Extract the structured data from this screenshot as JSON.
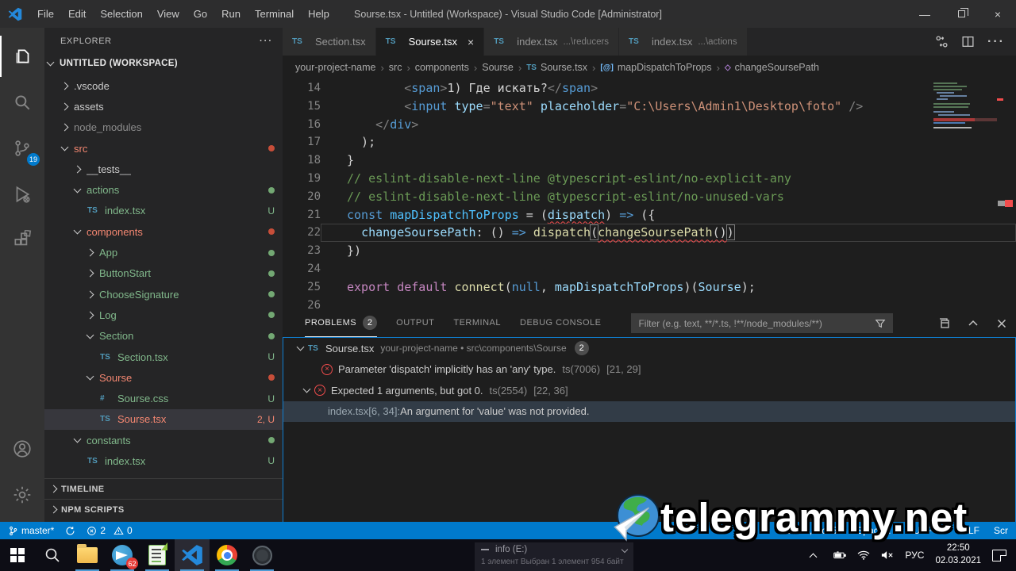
{
  "window": {
    "title": "Sourse.tsx - Untitled (Workspace) - Visual Studio Code [Administrator]",
    "menus": [
      "File",
      "Edit",
      "Selection",
      "View",
      "Go",
      "Run",
      "Terminal",
      "Help"
    ],
    "controls": {
      "minimize": "—",
      "close": "×"
    }
  },
  "activity": {
    "scm_badge": "19"
  },
  "explorer": {
    "header": "EXPLORER",
    "more": "···",
    "workspace": "UNTITLED (WORKSPACE)",
    "items": [
      {
        "indent": 0,
        "chev": "right",
        "label": ".vscode",
        "color": "default"
      },
      {
        "indent": 0,
        "chev": "right",
        "label": "assets",
        "color": "default"
      },
      {
        "indent": 0,
        "chev": "right",
        "label": "node_modules",
        "color": "dim"
      },
      {
        "indent": 0,
        "chev": "down",
        "label": "src",
        "color": "red",
        "dot": "red"
      },
      {
        "indent": 1,
        "chev": "right",
        "label": "__tests__",
        "color": "default"
      },
      {
        "indent": 1,
        "chev": "down",
        "label": "actions",
        "color": "green",
        "dot": "green"
      },
      {
        "indent": 2,
        "icon": "TS",
        "label": "index.tsx",
        "color": "green",
        "badge": "U"
      },
      {
        "indent": 1,
        "chev": "down",
        "label": "components",
        "color": "red",
        "dot": "red"
      },
      {
        "indent": 2,
        "chev": "right",
        "label": "App",
        "color": "green",
        "dot": "green"
      },
      {
        "indent": 2,
        "chev": "right",
        "label": "ButtonStart",
        "color": "green",
        "dot": "green"
      },
      {
        "indent": 2,
        "chev": "right",
        "label": "ChooseSignature",
        "color": "green",
        "dot": "green"
      },
      {
        "indent": 2,
        "chev": "right",
        "label": "Log",
        "color": "green",
        "dot": "green"
      },
      {
        "indent": 2,
        "chev": "down",
        "label": "Section",
        "color": "green",
        "dot": "green"
      },
      {
        "indent": 3,
        "icon": "TS",
        "label": "Section.tsx",
        "color": "green",
        "badge": "U"
      },
      {
        "indent": 2,
        "chev": "down",
        "label": "Sourse",
        "color": "red",
        "dot": "red"
      },
      {
        "indent": 3,
        "icon": "#",
        "label": "Sourse.css",
        "color": "green",
        "badge": "U"
      },
      {
        "indent": 3,
        "icon": "TS",
        "label": "Sourse.tsx",
        "color": "red",
        "badge": "2, U",
        "selected": true
      },
      {
        "indent": 1,
        "chev": "down",
        "label": "constants",
        "color": "green",
        "dot": "green"
      },
      {
        "indent": 2,
        "icon": "TS",
        "label": "index.tsx",
        "color": "green",
        "badge": "U"
      }
    ],
    "sections": [
      "TIMELINE",
      "NPM SCRIPTS"
    ]
  },
  "tabs": [
    {
      "icon": "TS",
      "label": "Section.tsx",
      "detail": "",
      "active": false,
      "close": false
    },
    {
      "icon": "TS",
      "label": "Sourse.tsx",
      "detail": "",
      "active": true,
      "close": true
    },
    {
      "icon": "TS",
      "label": "index.tsx",
      "detail": "...\\reducers",
      "active": false,
      "close": false
    },
    {
      "icon": "TS",
      "label": "index.tsx",
      "detail": "...\\actions",
      "active": false,
      "close": false
    }
  ],
  "breadcrumbs": [
    {
      "label": "your-project-name"
    },
    {
      "label": "src"
    },
    {
      "label": "components"
    },
    {
      "label": "Sourse"
    },
    {
      "label": "Sourse.tsx",
      "sym": "TS",
      "symColor": "#519aba"
    },
    {
      "label": "mapDispatchToProps",
      "sym": "[@]",
      "symColor": "#75beff"
    },
    {
      "label": "changeSoursePath",
      "sym": "◇",
      "symColor": "#b180d7"
    }
  ],
  "editor": {
    "lines": [
      {
        "num": "14",
        "segs": [
          {
            "t": "        ",
            "c": "txt"
          },
          {
            "t": "<",
            "c": "punct"
          },
          {
            "t": "span",
            "c": "tag"
          },
          {
            "t": ">",
            "c": "punct"
          },
          {
            "t": "1) Где искать?",
            "c": "txt"
          },
          {
            "t": "</",
            "c": "punct"
          },
          {
            "t": "span",
            "c": "tag"
          },
          {
            "t": ">",
            "c": "punct"
          }
        ]
      },
      {
        "num": "15",
        "segs": [
          {
            "t": "        ",
            "c": "txt"
          },
          {
            "t": "<",
            "c": "punct"
          },
          {
            "t": "input",
            "c": "tag"
          },
          {
            "t": " ",
            "c": "txt"
          },
          {
            "t": "type",
            "c": "attr"
          },
          {
            "t": "=",
            "c": "punct"
          },
          {
            "t": "\"text\"",
            "c": "str"
          },
          {
            "t": " ",
            "c": "txt"
          },
          {
            "t": "placeholder",
            "c": "attr"
          },
          {
            "t": "=",
            "c": "punct"
          },
          {
            "t": "\"C:\\Users\\Admin1\\Desktop\\foto\"",
            "c": "str"
          },
          {
            "t": " ",
            "c": "txt"
          },
          {
            "t": "/>",
            "c": "punct"
          }
        ]
      },
      {
        "num": "16",
        "segs": [
          {
            "t": "    ",
            "c": "txt"
          },
          {
            "t": "</",
            "c": "punct"
          },
          {
            "t": "div",
            "c": "tag"
          },
          {
            "t": ">",
            "c": "punct"
          }
        ]
      },
      {
        "num": "17",
        "segs": [
          {
            "t": "  );",
            "c": "txt"
          }
        ]
      },
      {
        "num": "18",
        "segs": [
          {
            "t": "}",
            "c": "txt"
          }
        ]
      },
      {
        "num": "19",
        "segs": [
          {
            "t": "// eslint-disable-next-line @typescript-eslint/no-explicit-any",
            "c": "cm"
          }
        ]
      },
      {
        "num": "20",
        "segs": [
          {
            "t": "// eslint-disable-next-line @typescript-eslint/no-unused-vars",
            "c": "cm"
          }
        ]
      },
      {
        "num": "21",
        "segs": [
          {
            "t": "const",
            "c": "kw"
          },
          {
            "t": " ",
            "c": "txt"
          },
          {
            "t": "mapDispatchToProps",
            "c": "cvar"
          },
          {
            "t": " = (",
            "c": "txt"
          },
          {
            "t": "dispatch",
            "c": "var sq"
          },
          {
            "t": ") ",
            "c": "txt"
          },
          {
            "t": "=>",
            "c": "kw"
          },
          {
            "t": " ({",
            "c": "txt"
          }
        ]
      },
      {
        "num": "22",
        "current": true,
        "segs": [
          {
            "t": "  ",
            "c": "txt"
          },
          {
            "t": "changeSoursePath",
            "c": "var"
          },
          {
            "t": ": () ",
            "c": "txt"
          },
          {
            "t": "=>",
            "c": "kw"
          },
          {
            "t": " ",
            "c": "txt"
          },
          {
            "t": "dispatch",
            "c": "fn"
          },
          {
            "t": "(",
            "c": "txt br"
          },
          {
            "t": "changeSoursePath",
            "c": "fn sq"
          },
          {
            "t": "()",
            "c": "txt sq"
          },
          {
            "t": ")",
            "c": "txt br"
          }
        ]
      },
      {
        "num": "23",
        "segs": [
          {
            "t": "})",
            "c": "txt"
          }
        ]
      },
      {
        "num": "24",
        "segs": []
      },
      {
        "num": "25",
        "segs": [
          {
            "t": "export",
            "c": "kw2"
          },
          {
            "t": " ",
            "c": "txt"
          },
          {
            "t": "default",
            "c": "kw2"
          },
          {
            "t": " ",
            "c": "txt"
          },
          {
            "t": "connect",
            "c": "fn"
          },
          {
            "t": "(",
            "c": "txt"
          },
          {
            "t": "null",
            "c": "kw"
          },
          {
            "t": ", ",
            "c": "txt"
          },
          {
            "t": "mapDispatchToProps",
            "c": "var"
          },
          {
            "t": ")(",
            "c": "txt"
          },
          {
            "t": "Sourse",
            "c": "var"
          },
          {
            "t": ");",
            "c": "txt"
          }
        ]
      },
      {
        "num": "26",
        "segs": []
      }
    ]
  },
  "panel": {
    "tabs": [
      {
        "label": "PROBLEMS",
        "active": true,
        "badge": "2"
      },
      {
        "label": "OUTPUT",
        "active": false
      },
      {
        "label": "TERMINAL",
        "active": false
      },
      {
        "label": "DEBUG CONSOLE",
        "active": false
      }
    ],
    "filter_placeholder": "Filter (e.g. text, **/*.ts, !**/node_modules/**)",
    "file_group": {
      "file": "Sourse.tsx",
      "path": "your-project-name • src\\components\\Sourse",
      "count": "2"
    },
    "errors": [
      {
        "msg": "Parameter 'dispatch' implicitly has an 'any' type.",
        "code": "ts(7006)",
        "pos": "[21, 29]"
      },
      {
        "msg": "Expected 1 arguments, but got 0.",
        "code": "ts(2554)",
        "pos": "[22, 36]"
      }
    ],
    "related": {
      "prefix": "index.tsx[6, 34]: ",
      "msg": "An argument for 'value' was not provided."
    }
  },
  "status": {
    "branch": "master*",
    "errors": "2",
    "warnings": "0",
    "right": [
      "Ln 22, Col 54",
      "Spaces: 2",
      "UTF-8",
      "CRLF",
      "Scr"
    ]
  },
  "taskbar": {
    "telegram_badge": "62",
    "tray": {
      "lang": "РУС",
      "time": "22:50",
      "date": "02.03.2021"
    },
    "popup": {
      "title": "info (E:)",
      "sub": "1 элемент    Выбран 1 элемент 954 байт"
    }
  },
  "watermark": {
    "text": "telegrammy.net"
  },
  "colors": {
    "accent": "#007acc",
    "error": "#f14c4c",
    "git_green": "#81b88b",
    "git_red": "#f48771"
  }
}
